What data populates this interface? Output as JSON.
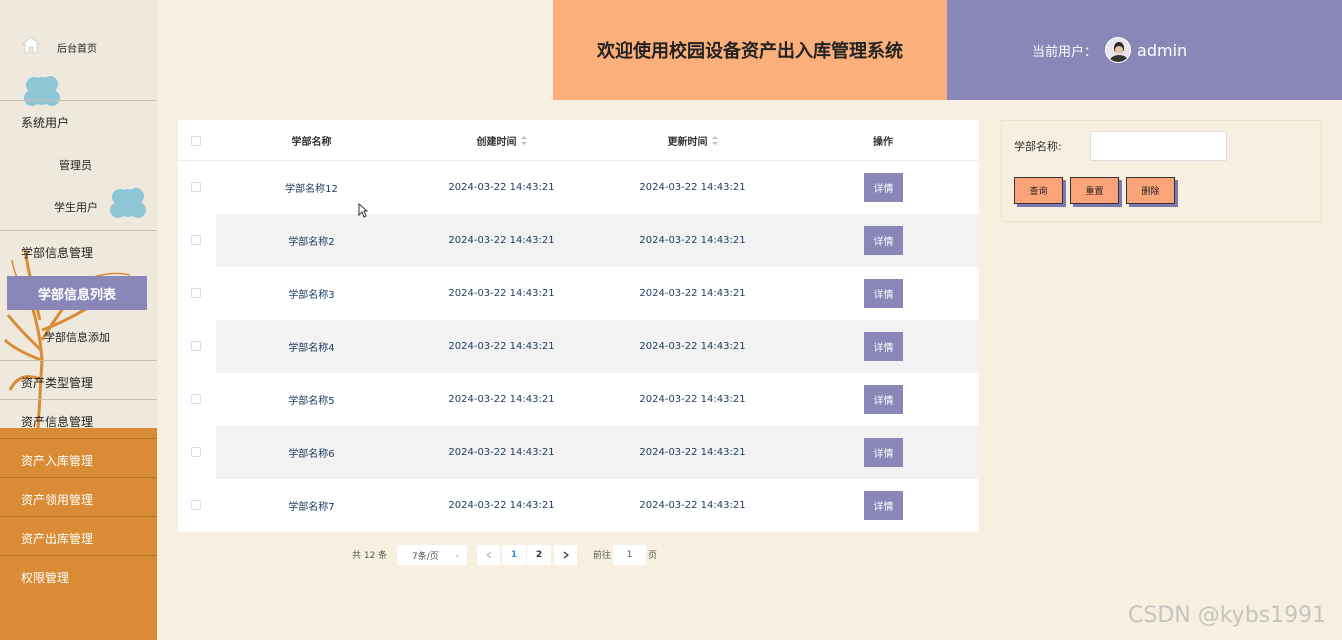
{
  "sidebar": {
    "home": "后台首页",
    "groups": [
      {
        "label": "系统用户",
        "items": [
          "管理员",
          "学生用户"
        ]
      },
      {
        "label": "学部信息管理",
        "items": [
          "学部信息列表",
          "学部信息添加"
        ]
      }
    ],
    "menus": [
      "资产类型管理",
      "资产信息管理",
      "资产入库管理",
      "资产领用管理",
      "资产出库管理",
      "权限管理"
    ]
  },
  "header": {
    "title": "欢迎使用校园设备资产出入库管理系统",
    "user_label": "当前用户：",
    "username": "admin"
  },
  "table": {
    "columns": [
      "学部名称",
      "创建时间",
      "更新时间",
      "操作"
    ],
    "action_label": "详情",
    "rows": [
      {
        "name": "学部名称12",
        "created": "2024-03-22 14:43:21",
        "updated": "2024-03-22 14:43:21"
      },
      {
        "name": "学部名称2",
        "created": "2024-03-22 14:43:21",
        "updated": "2024-03-22 14:43:21"
      },
      {
        "name": "学部名称3",
        "created": "2024-03-22 14:43:21",
        "updated": "2024-03-22 14:43:21"
      },
      {
        "name": "学部名称4",
        "created": "2024-03-22 14:43:21",
        "updated": "2024-03-22 14:43:21"
      },
      {
        "name": "学部名称5",
        "created": "2024-03-22 14:43:21",
        "updated": "2024-03-22 14:43:21"
      },
      {
        "name": "学部名称6",
        "created": "2024-03-22 14:43:21",
        "updated": "2024-03-22 14:43:21"
      },
      {
        "name": "学部名称7",
        "created": "2024-03-22 14:43:21",
        "updated": "2024-03-22 14:43:21"
      }
    ]
  },
  "pagination": {
    "total": "共 12 条",
    "page_size": "7条/页",
    "pages": [
      "1",
      "2"
    ],
    "current_page": "1",
    "goto_label": "前往",
    "goto_value": "1",
    "page_suffix": "页"
  },
  "search": {
    "label": "学部名称:",
    "value": "",
    "query_button": "查询",
    "reset_button": "重置",
    "delete_button": "删除"
  },
  "watermark": "CSDN @kybs1991",
  "colors": {
    "accent_purple": "#8a87b8",
    "accent_orange": "#fbb07c",
    "sidebar_orange": "#d98b35",
    "background": "#f7f0e0"
  }
}
